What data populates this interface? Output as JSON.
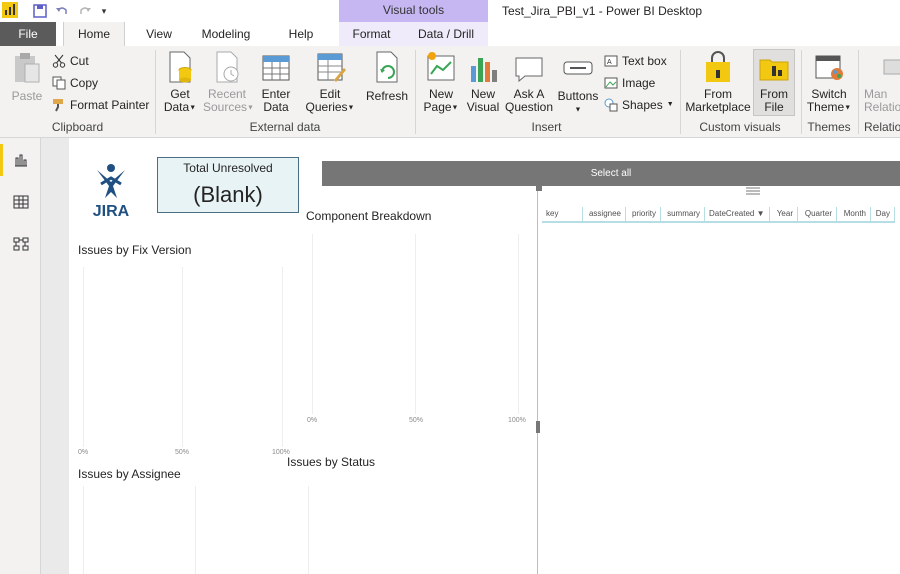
{
  "window": {
    "title": "Test_Jira_PBI_v1 - Power BI Desktop",
    "context_group": "Visual tools"
  },
  "tabs": [
    {
      "label": "File"
    },
    {
      "label": "Home"
    },
    {
      "label": "View"
    },
    {
      "label": "Modeling"
    },
    {
      "label": "Help"
    },
    {
      "label": "Format"
    },
    {
      "label": "Data / Drill"
    }
  ],
  "ribbon": {
    "clipboard": {
      "paste": "Paste",
      "cut": "Cut",
      "copy": "Copy",
      "format_painter": "Format Painter",
      "group": "Clipboard"
    },
    "external_data": {
      "get_data_1": "Get",
      "get_data_2": "Data",
      "recent_1": "Recent",
      "recent_2": "Sources",
      "enter_1": "Enter",
      "enter_2": "Data",
      "edit_1": "Edit",
      "edit_2": "Queries",
      "refresh": "Refresh",
      "group": "External data"
    },
    "insert": {
      "new_page_1": "New",
      "new_page_2": "Page",
      "new_visual_1": "New",
      "new_visual_2": "Visual",
      "ask_1": "Ask A",
      "ask_2": "Question",
      "buttons": "Buttons",
      "text_box": "Text box",
      "image": "Image",
      "shapes": "Shapes",
      "group": "Insert"
    },
    "custom_visuals": {
      "market_1": "From",
      "market_2": "Marketplace",
      "file_1": "From",
      "file_2": "File",
      "group": "Custom visuals"
    },
    "themes": {
      "switch_1": "Switch",
      "switch_2": "Theme",
      "group": "Themes"
    },
    "relationships": {
      "manage_1": "Man",
      "manage_2": "Relatio",
      "group": "Relatio"
    }
  },
  "canvas": {
    "logo_text": "JIRA",
    "card": {
      "title": "Total Unresolved",
      "value": "(Blank)"
    },
    "slicer_label": "Select all",
    "charts": {
      "fix_version": {
        "title": "Issues by Fix Version",
        "ticks": [
          "0%",
          "50%",
          "100%"
        ]
      },
      "component": {
        "title": "Component Breakdown",
        "ticks": [
          "0%",
          "50%",
          "100%"
        ]
      },
      "assignee": {
        "title": "Issues by Assignee"
      },
      "status": {
        "title": "Issues by Status"
      }
    },
    "table_columns": [
      "key",
      "assignee",
      "priority",
      "summary",
      "DateCreated",
      "Year",
      "Quarter",
      "Month",
      "Day"
    ]
  },
  "colors": {
    "accent": "#f2c811",
    "file_tab": "#5b5b5b",
    "context": "#c6b7f3",
    "card_border": "#4a6f82",
    "slicer": "#767676"
  }
}
